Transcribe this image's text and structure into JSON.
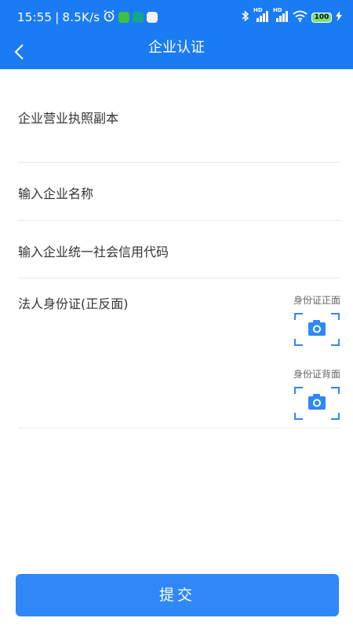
{
  "status_bar": {
    "time": "15:55",
    "net_speed": "8.5K/s",
    "battery": "100",
    "icons": [
      "alarm-icon",
      "app-icon",
      "app-icon",
      "app-icon",
      "bluetooth-icon",
      "signal-icon",
      "signal-icon",
      "wifi-icon",
      "battery-icon",
      "charging-icon"
    ],
    "network_labels": [
      "HD",
      "HD"
    ]
  },
  "nav": {
    "back_icon": "chevron-left-icon",
    "title": "企业认证"
  },
  "form": {
    "license_label": "企业营业执照副本",
    "name_placeholder": "输入企业名称",
    "credit_code_placeholder": "输入企业统一社会信用代码",
    "id_card_label": "法人身份证(正反面)",
    "id_front_caption": "身份证正面",
    "id_back_caption": "身份证背面",
    "camera_icon": "camera-icon"
  },
  "submit": {
    "label": "提交"
  },
  "colors": {
    "primary": "#1A7BF2",
    "button": "#2F88F5",
    "text": "#333333",
    "caption": "#666666"
  }
}
